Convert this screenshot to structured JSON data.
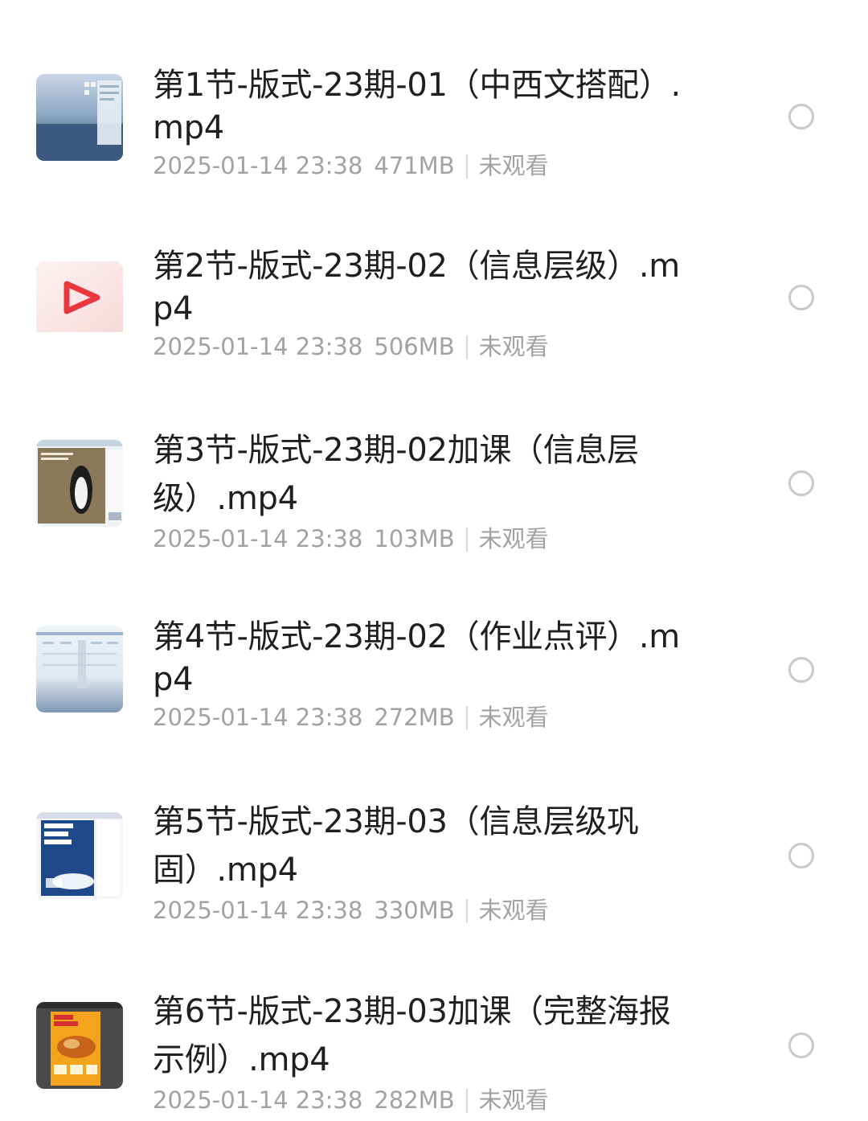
{
  "files": [
    {
      "name": "第1节-版式-23期-01（中西文搭配）.mp4",
      "date": "2025-01-14 23:38",
      "size": "471MB",
      "status": "未观看",
      "thumb_icon": "video-thumbnail-desktop-icon"
    },
    {
      "name": "第2节-版式-23期-02（信息层级）.mp4",
      "date": "2025-01-14 23:38",
      "size": "506MB",
      "status": "未观看",
      "thumb_icon": "video-play-icon"
    },
    {
      "name": "第3节-版式-23期-02加课（信息层级）.mp4",
      "date": "2025-01-14 23:38",
      "size": "103MB",
      "status": "未观看",
      "thumb_icon": "video-thumbnail-poster-icon"
    },
    {
      "name": "第4节-版式-23期-02（作业点评）.mp4",
      "date": "2025-01-14 23:38",
      "size": "272MB",
      "status": "未观看",
      "thumb_icon": "video-thumbnail-desktop-icon"
    },
    {
      "name": "第5节-版式-23期-03（信息层级巩固）.mp4",
      "date": "2025-01-14 23:38",
      "size": "330MB",
      "status": "未观看",
      "thumb_icon": "video-thumbnail-poster-icon"
    },
    {
      "name": "第6节-版式-23期-03加课（完整海报示例）.mp4",
      "date": "2025-01-14 23:38",
      "size": "282MB",
      "status": "未观看",
      "thumb_icon": "video-thumbnail-poster-icon"
    }
  ],
  "colors": {
    "title": "#1f1f1f",
    "meta": "#a2a2a2",
    "radio_border": "#c9c9c9",
    "play_icon": "#e8383d"
  }
}
